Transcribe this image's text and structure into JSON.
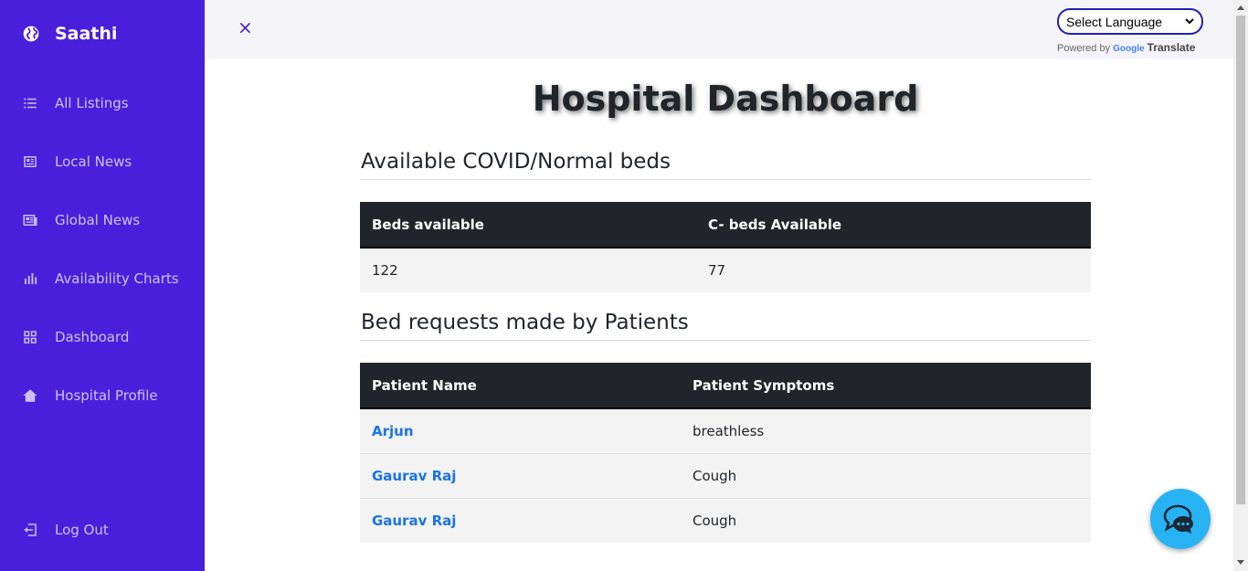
{
  "sidebar": {
    "brand": "Saathi",
    "items": [
      {
        "label": "All Listings",
        "icon": "list-icon"
      },
      {
        "label": "Local News",
        "icon": "newspaper-icon"
      },
      {
        "label": "Global News",
        "icon": "news-icon"
      },
      {
        "label": "Availability Charts",
        "icon": "bar-chart-icon"
      },
      {
        "label": "Dashboard",
        "icon": "grid-icon"
      },
      {
        "label": "Hospital Profile",
        "icon": "home-icon"
      }
    ],
    "logout": "Log Out"
  },
  "topbar": {
    "close_icon": "×",
    "language_select": "Select Language",
    "powered_by": "Powered by",
    "google": "Google",
    "translate": "Translate"
  },
  "main": {
    "title": "Hospital Dashboard",
    "beds_section": {
      "title": "Available COVID/Normal beds",
      "headers": [
        "Beds available",
        "C- beds Available"
      ],
      "row": [
        "122",
        "77"
      ]
    },
    "requests_section": {
      "title": "Bed requests made by Patients",
      "headers": [
        "Patient Name",
        "Patient Symptoms"
      ],
      "rows": [
        {
          "name": "Arjun",
          "symptoms": "breathless"
        },
        {
          "name": "Gaurav Raj",
          "symptoms": "Cough"
        },
        {
          "name": "Gaurav Raj",
          "symptoms": "Cough"
        }
      ]
    }
  },
  "colors": {
    "sidebar": "#4a1fdc",
    "accent_link": "#1a73e8",
    "table_header": "#212529",
    "chat_button": "#27b2f4"
  }
}
